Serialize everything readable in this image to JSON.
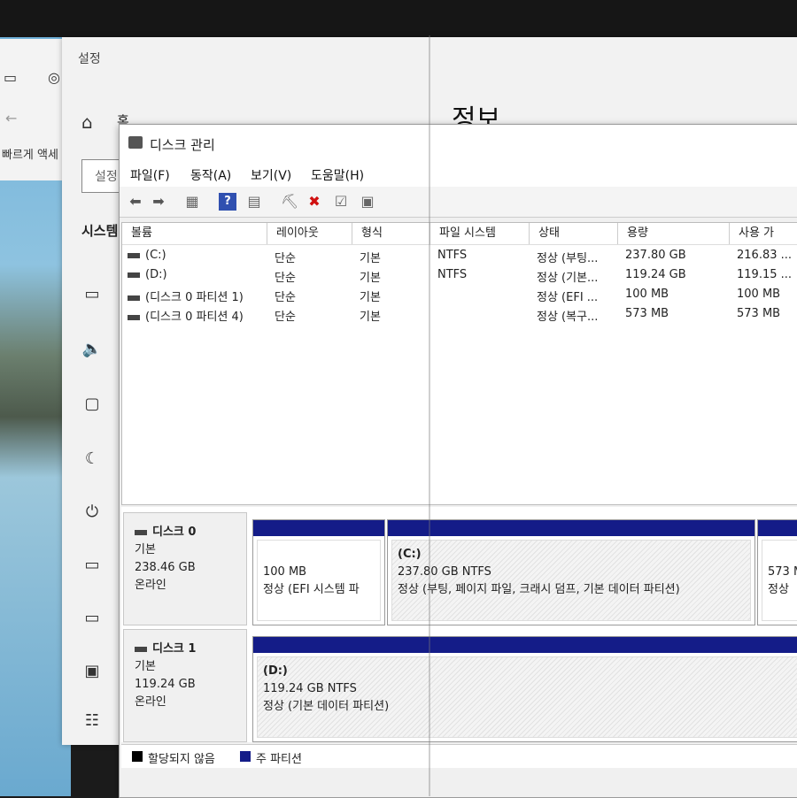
{
  "explorer": {
    "quick_access": "빠르게 액세"
  },
  "settings": {
    "title": "설정",
    "home": "홈",
    "page_title": "정보",
    "search": "설정",
    "section": "시스템"
  },
  "disk_mgmt": {
    "title": "디스크 관리",
    "menu": [
      "파일(F)",
      "동작(A)",
      "보기(V)",
      "도움말(H)"
    ],
    "columns": [
      "볼륨",
      "레이아웃",
      "형식",
      "파일 시스템",
      "상태",
      "용량",
      "사용 가"
    ],
    "volumes": [
      {
        "volume": "(C:)",
        "layout": "단순",
        "type": "기본",
        "fs": "NTFS",
        "status": "정상 (부팅...",
        "capacity": "237.80 GB",
        "free": "216.83 ..."
      },
      {
        "volume": "(D:)",
        "layout": "단순",
        "type": "기본",
        "fs": "NTFS",
        "status": "정상 (기본...",
        "capacity": "119.24 GB",
        "free": "119.15 ..."
      },
      {
        "volume": "(디스크 0 파티션 1)",
        "layout": "단순",
        "type": "기본",
        "fs": "",
        "status": "정상 (EFI ...",
        "capacity": "100 MB",
        "free": "100 MB"
      },
      {
        "volume": "(디스크 0 파티션 4)",
        "layout": "단순",
        "type": "기본",
        "fs": "",
        "status": "정상 (복구...",
        "capacity": "573 MB",
        "free": "573 MB"
      }
    ],
    "disks": [
      {
        "name": "디스크 0",
        "type": "기본",
        "size": "238.46 GB",
        "state": "온라인",
        "partitions": [
          {
            "title": "",
            "size": "100 MB",
            "status": "정상 (EFI 시스템 파"
          },
          {
            "title": "(C:)",
            "size": "237.80 GB NTFS",
            "status": "정상 (부팅, 페이지 파일, 크래시 덤프, 기본 데이터 파티션)"
          },
          {
            "title": "",
            "size": "573 M",
            "status": "정상"
          }
        ]
      },
      {
        "name": "디스크 1",
        "type": "기본",
        "size": "119.24 GB",
        "state": "온라인",
        "partitions": [
          {
            "title": "(D:)",
            "size": "119.24 GB NTFS",
            "status": "정상 (기본 데이터 파티션)"
          }
        ]
      }
    ],
    "legend": {
      "unallocated": "할당되지 않음",
      "primary": "주 파티션"
    },
    "colors": {
      "primary_bar": "#141c88",
      "unallocated": "#000000"
    }
  }
}
